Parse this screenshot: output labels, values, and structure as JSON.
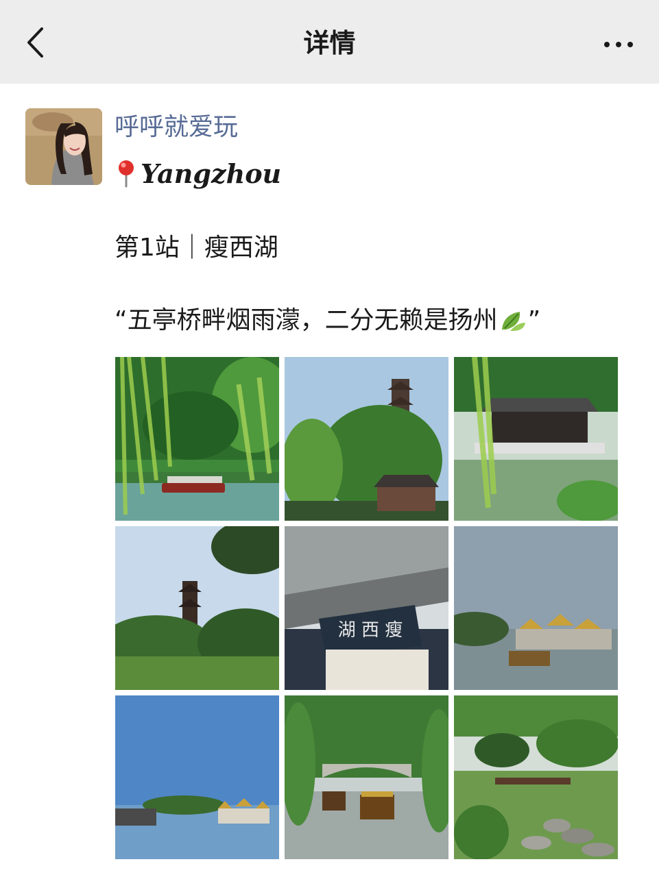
{
  "header": {
    "title": "详情"
  },
  "author": {
    "name": "呼呼就爱玩",
    "location": "Yangzhou"
  },
  "post": {
    "line1": "第1站｜瘦西湖",
    "line2_open": "“五亭桥畔烟雨濛，二分无赖是扬州",
    "line2_close": "”"
  },
  "colors": {
    "header_bg": "#ededed",
    "link_blue": "#576b95",
    "text": "#1a1a1a"
  },
  "icons": [
    "back-chevron-icon",
    "more-dots-icon",
    "location-pin-icon",
    "leaf-icon"
  ]
}
